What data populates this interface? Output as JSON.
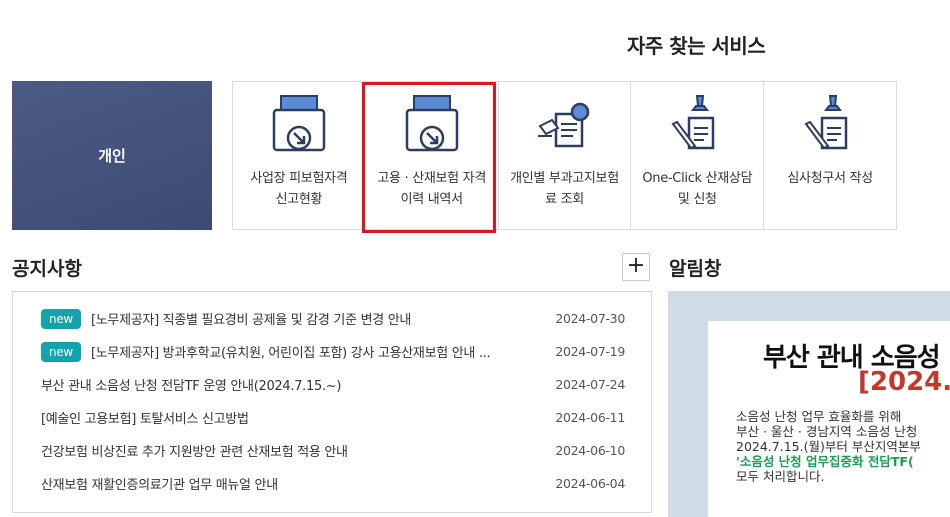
{
  "services": {
    "title": "자주 찾는 서비스",
    "personal_tile": "개인",
    "items": [
      {
        "label": "사업장 피보험자격 신고현황",
        "icon": "folder-arrow-icon"
      },
      {
        "label": "고용 · 산재보험 자격 이력 내역서",
        "icon": "folder-arrow-icon"
      },
      {
        "label": "개인별 부과고지보험료 조회",
        "icon": "document-search-icon"
      },
      {
        "label": "One-Click 산재상담 및 신청",
        "icon": "pen-document-icon"
      },
      {
        "label": "심사청구서 작성",
        "icon": "pen-document-icon"
      }
    ],
    "highlight_color": "#e0161f"
  },
  "notices": {
    "title": "공지사항",
    "more_label": "+",
    "new_badge": "new",
    "items": [
      {
        "text": "[노무제공자] 직종별 필요경비 공제율 및 감경 기준 변경 안내",
        "date": "2024-07-30",
        "new": true
      },
      {
        "text": "[노무제공자] 방과후학교(유치원, 어린이집 포함) 강사 고용산재보험 안내 ...",
        "date": "2024-07-19",
        "new": true
      },
      {
        "text": "부산 관내 소음성 난청 전담TF 운영 안내(2024.7.15.~)",
        "date": "2024-07-24",
        "new": false
      },
      {
        "text": "[예술인 고용보험] 토탈서비스 신고방법",
        "date": "2024-06-11",
        "new": false
      },
      {
        "text": "건강보험 비상진료 추가 지원방안 관련 산재보험 적용 안내",
        "date": "2024-06-10",
        "new": false
      },
      {
        "text": "산재보험 재활인증의료기관 업무 매뉴얼 안내",
        "date": "2024-06-04",
        "new": false
      }
    ]
  },
  "alarm": {
    "title": "알림창",
    "banner_head": "부산 관내 소음성",
    "banner_sub": "[2024.",
    "banner_lines": [
      "소음성 난청 업무 효율화를 위해",
      "부산 · 울산 · 경남지역 소음성 난청",
      "2024.7.15.(월)부터 부산지역본부",
      "'소음성 난청 업무집중화 전담TF(",
      "모두 처리합니다."
    ]
  }
}
